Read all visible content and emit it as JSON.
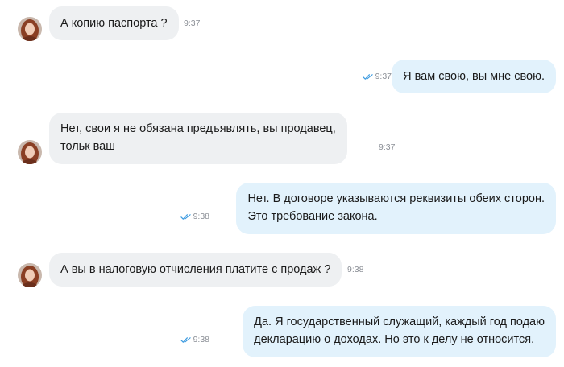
{
  "colors": {
    "incoming_bubble": "#eef0f2",
    "outgoing_bubble": "#e2f2fc",
    "read_check": "#3d9be0",
    "timestamp": "#8b8f96"
  },
  "messages": [
    {
      "direction": "incoming",
      "text": "А копию паспорта ?",
      "time": "9:37"
    },
    {
      "direction": "outgoing",
      "text": "Я вам свою, вы мне свою.",
      "time": "9:37",
      "status_icon": "double-check-icon"
    },
    {
      "direction": "incoming",
      "lines": [
        "Нет, свои я не обязана предъявлять, вы продавец,",
        "тольк ваш"
      ],
      "time": "9:37"
    },
    {
      "direction": "outgoing",
      "lines": [
        "Нет. В договоре указываются реквизиты обеих сторон.",
        "Это требование закона."
      ],
      "time": "9:38",
      "status_icon": "double-check-icon"
    },
    {
      "direction": "incoming",
      "text": "А вы в налоговую отчисления платите с продаж ?",
      "time": "9:38"
    },
    {
      "direction": "outgoing",
      "lines": [
        "Да. Я государственный служащий, каждый год подаю",
        "декларацию о доходах. Но это к делу не относится."
      ],
      "time": "9:38",
      "status_icon": "double-check-icon"
    }
  ]
}
